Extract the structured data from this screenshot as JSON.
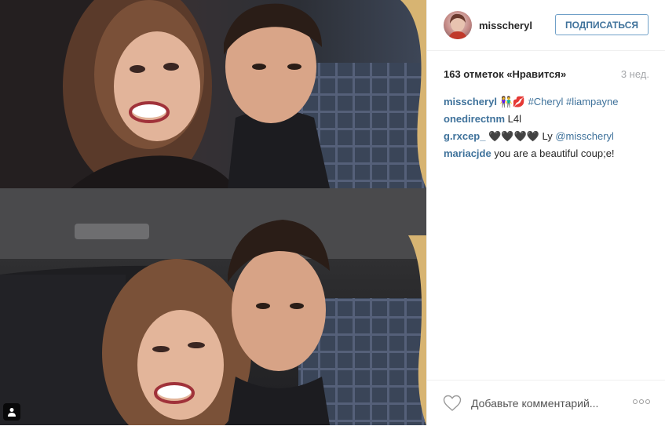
{
  "post": {
    "username": "misscheryl",
    "follow_label": "ПОДПИСАТЬСЯ",
    "likes": "163 отметок «Нравится»",
    "time_ago": "3 нед."
  },
  "comments": [
    {
      "user": "misscheryl",
      "emoji": "👫💋",
      "parts": [
        {
          "t": " "
        },
        {
          "link": "#Cheryl"
        },
        {
          "t": " "
        },
        {
          "link": "#liampayne"
        }
      ]
    },
    {
      "user": "onedirectnm",
      "parts": [
        {
          "t": " L4l"
        }
      ]
    },
    {
      "user": "g.rxcep_",
      "emoji": "🖤🖤🖤🖤",
      "parts": [
        {
          "t": " Ly "
        },
        {
          "link": "@misscheryl"
        }
      ]
    },
    {
      "user": "mariacjde",
      "parts": [
        {
          "t": " you are a beautiful coup;e!"
        }
      ]
    }
  ],
  "add_comment_placeholder": "Добавьте комментарий...",
  "icons": {
    "like": "heart-icon",
    "more": "more-options-icon",
    "tagged": "user-tag-icon"
  },
  "colors": {
    "link": "#3f729b",
    "follow_border": "#70a0c8",
    "muted": "#a5a7aa"
  }
}
